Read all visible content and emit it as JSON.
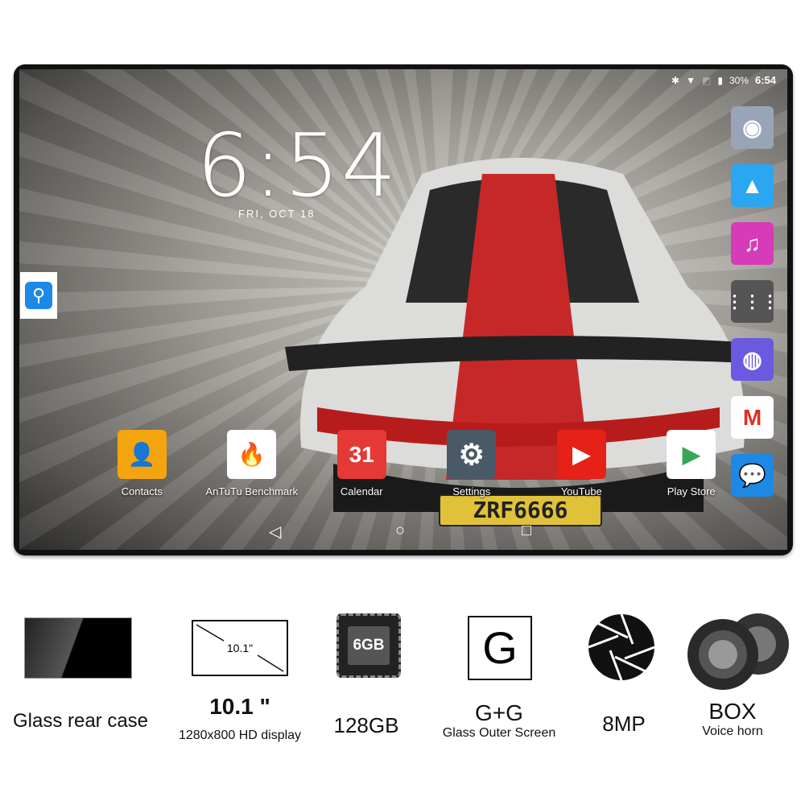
{
  "status": {
    "battery": "30%",
    "time": "6:54",
    "icons": [
      "bluetooth-icon",
      "wifi-icon",
      "no-sim-icon",
      "battery-icon"
    ]
  },
  "clock": {
    "time": "6:54",
    "date": "FRI, OCT 18"
  },
  "plate": "ZRF6666",
  "dock": [
    {
      "name": "camera",
      "color": "#9aa4b8"
    },
    {
      "name": "gallery",
      "color": "#2aa7f0"
    },
    {
      "name": "music",
      "color": "#d63bb8"
    },
    {
      "name": "app-drawer",
      "color": "#555"
    },
    {
      "name": "browser",
      "color": "#6a5ae0"
    },
    {
      "name": "gmail",
      "color": "#fff"
    },
    {
      "name": "messages",
      "color": "#1e88e5"
    }
  ],
  "apps": [
    {
      "label": "Contacts",
      "color": "#f4a40e",
      "glyph": "👤"
    },
    {
      "label": "AnTuTu Benchmark",
      "color": "#fff",
      "glyph": "🔥"
    },
    {
      "label": "Calendar",
      "color": "#e53935",
      "glyph": "31"
    },
    {
      "label": "Settings",
      "color": "#4a5968",
      "glyph": "⚙"
    },
    {
      "label": "YouTube",
      "color": "#e62117",
      "glyph": "▶"
    },
    {
      "label": "Play Store",
      "color": "#fff",
      "glyph": "▶"
    }
  ],
  "nav": {
    "back": "◁",
    "home": "○",
    "recents": "□"
  },
  "features": [
    {
      "title": "Glass rear case",
      "sub": ""
    },
    {
      "title": "10.1 \"",
      "sub": "1280x800 HD display",
      "icon_text": "10.1\""
    },
    {
      "title": "128GB",
      "sub": "",
      "icon_text": "6GB"
    },
    {
      "title": "G+G",
      "sub": "Glass Outer Screen",
      "icon_text": "G"
    },
    {
      "title": "8MP",
      "sub": ""
    },
    {
      "title": "BOX",
      "sub": "Voice horn"
    }
  ]
}
